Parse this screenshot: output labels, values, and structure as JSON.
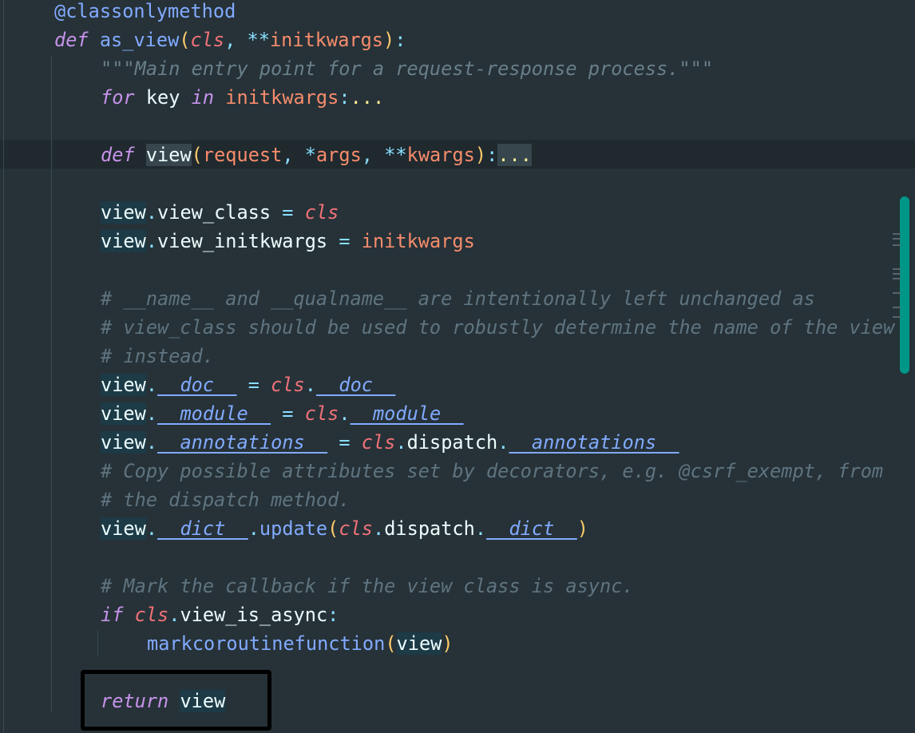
{
  "editor": {
    "lines": [
      {
        "tokens": [
          {
            "t": "@classonlymethod",
            "c": "tok-deco"
          }
        ]
      },
      {
        "tokens": [
          {
            "t": "def",
            "c": "tok-kw"
          },
          {
            "t": " "
          },
          {
            "t": "as_view",
            "c": "tok-fn"
          },
          {
            "t": "(",
            "c": "tok-paren"
          },
          {
            "t": "cls",
            "c": "tok-self"
          },
          {
            "t": ", ",
            "c": "tok-punct"
          },
          {
            "t": "**",
            "c": "tok-op"
          },
          {
            "t": "initkwargs",
            "c": "tok-param"
          },
          {
            "t": ")",
            "c": "tok-paren"
          },
          {
            "t": ":",
            "c": "tok-punct"
          }
        ]
      },
      {
        "tokens": [
          {
            "t": "\"\"\"Main entry point for a request-response process.\"\"\"",
            "c": "tok-doc"
          }
        ]
      },
      {
        "tokens": [
          {
            "t": "for",
            "c": "tok-kw"
          },
          {
            "t": " key ",
            "c": "tok-var"
          },
          {
            "t": "in",
            "c": "tok-kw"
          },
          {
            "t": " "
          },
          {
            "t": "initkwargs",
            "c": "tok-param"
          },
          {
            "t": ":",
            "c": "tok-punct"
          },
          {
            "t": "...",
            "c": "tok-fold"
          }
        ]
      },
      {
        "tokens": []
      },
      {
        "tokens": [
          {
            "t": "def",
            "c": "tok-kw"
          },
          {
            "t": " "
          },
          {
            "t": "view",
            "c": "tok-var hl-word"
          },
          {
            "t": "(",
            "c": "tok-paren"
          },
          {
            "t": "request",
            "c": "tok-param"
          },
          {
            "t": ", ",
            "c": "tok-punct"
          },
          {
            "t": "*",
            "c": "tok-op"
          },
          {
            "t": "args",
            "c": "tok-param"
          },
          {
            "t": ", ",
            "c": "tok-punct"
          },
          {
            "t": "**",
            "c": "tok-op"
          },
          {
            "t": "kwargs",
            "c": "tok-param"
          },
          {
            "t": ")",
            "c": "tok-paren"
          },
          {
            "t": ":",
            "c": "tok-punct"
          },
          {
            "t": "...",
            "c": "tok-fold hl-word"
          }
        ]
      },
      {
        "tokens": []
      },
      {
        "tokens": [
          {
            "t": "view",
            "c": "tok-var hl-var"
          },
          {
            "t": ".",
            "c": "tok-punct"
          },
          {
            "t": "view_class",
            "c": "tok-var"
          },
          {
            "t": " = ",
            "c": "tok-op"
          },
          {
            "t": "cls",
            "c": "tok-self"
          }
        ]
      },
      {
        "tokens": [
          {
            "t": "view",
            "c": "tok-var hl-var"
          },
          {
            "t": ".",
            "c": "tok-punct"
          },
          {
            "t": "view_initkwargs",
            "c": "tok-var"
          },
          {
            "t": " = ",
            "c": "tok-op"
          },
          {
            "t": "initkwargs",
            "c": "tok-param"
          }
        ]
      },
      {
        "tokens": []
      },
      {
        "tokens": [
          {
            "t": "# __name__ and __qualname__ are intentionally left unchanged as",
            "c": "tok-comment"
          }
        ]
      },
      {
        "tokens": [
          {
            "t": "# view_class should be used to robustly determine the name of the view",
            "c": "tok-comment"
          }
        ]
      },
      {
        "tokens": [
          {
            "t": "# instead.",
            "c": "tok-comment"
          }
        ]
      },
      {
        "tokens": [
          {
            "t": "view",
            "c": "tok-var hl-var"
          },
          {
            "t": ".",
            "c": "tok-punct"
          },
          {
            "t": "__doc__",
            "c": "tok-dunder"
          },
          {
            "t": " = ",
            "c": "tok-op"
          },
          {
            "t": "cls",
            "c": "tok-self"
          },
          {
            "t": ".",
            "c": "tok-punct"
          },
          {
            "t": "__doc__",
            "c": "tok-dunder"
          }
        ]
      },
      {
        "tokens": [
          {
            "t": "view",
            "c": "tok-var hl-var"
          },
          {
            "t": ".",
            "c": "tok-punct"
          },
          {
            "t": "__module__",
            "c": "tok-dunder"
          },
          {
            "t": " = ",
            "c": "tok-op"
          },
          {
            "t": "cls",
            "c": "tok-self"
          },
          {
            "t": ".",
            "c": "tok-punct"
          },
          {
            "t": "__module__",
            "c": "tok-dunder"
          }
        ]
      },
      {
        "tokens": [
          {
            "t": "view",
            "c": "tok-var hl-var"
          },
          {
            "t": ".",
            "c": "tok-punct"
          },
          {
            "t": "__annotations__",
            "c": "tok-dunder"
          },
          {
            "t": " = ",
            "c": "tok-op"
          },
          {
            "t": "cls",
            "c": "tok-self"
          },
          {
            "t": ".",
            "c": "tok-punct"
          },
          {
            "t": "dispatch",
            "c": "tok-var"
          },
          {
            "t": ".",
            "c": "tok-punct"
          },
          {
            "t": "__annotations__",
            "c": "tok-dunder"
          }
        ]
      },
      {
        "tokens": [
          {
            "t": "# Copy possible attributes set by decorators, e.g. @csrf_exempt, from",
            "c": "tok-comment"
          }
        ]
      },
      {
        "tokens": [
          {
            "t": "# the dispatch method.",
            "c": "tok-comment"
          }
        ]
      },
      {
        "tokens": [
          {
            "t": "view",
            "c": "tok-var hl-var"
          },
          {
            "t": ".",
            "c": "tok-punct"
          },
          {
            "t": "__dict__",
            "c": "tok-dunder"
          },
          {
            "t": ".",
            "c": "tok-punct"
          },
          {
            "t": "update",
            "c": "tok-fn"
          },
          {
            "t": "(",
            "c": "tok-paren"
          },
          {
            "t": "cls",
            "c": "tok-self"
          },
          {
            "t": ".",
            "c": "tok-punct"
          },
          {
            "t": "dispatch",
            "c": "tok-var"
          },
          {
            "t": ".",
            "c": "tok-punct"
          },
          {
            "t": "__dict__",
            "c": "tok-dunder"
          },
          {
            "t": ")",
            "c": "tok-paren"
          }
        ]
      },
      {
        "tokens": []
      },
      {
        "tokens": [
          {
            "t": "# Mark the callback if the view class is async.",
            "c": "tok-comment"
          }
        ]
      },
      {
        "tokens": [
          {
            "t": "if",
            "c": "tok-kw"
          },
          {
            "t": " "
          },
          {
            "t": "cls",
            "c": "tok-self"
          },
          {
            "t": ".",
            "c": "tok-punct"
          },
          {
            "t": "view_is_async",
            "c": "tok-var"
          },
          {
            "t": ":",
            "c": "tok-punct"
          }
        ]
      },
      {
        "tokens": [
          {
            "t": "markcoroutinefunction",
            "c": "tok-fn"
          },
          {
            "t": "(",
            "c": "tok-paren"
          },
          {
            "t": "view",
            "c": "tok-var hl-var"
          },
          {
            "t": ")",
            "c": "tok-paren"
          }
        ]
      },
      {
        "tokens": []
      },
      {
        "tokens": [
          {
            "t": "return",
            "c": "tok-kw"
          },
          {
            "t": " "
          },
          {
            "t": "view",
            "c": "tok-var hl-var"
          }
        ]
      }
    ]
  }
}
